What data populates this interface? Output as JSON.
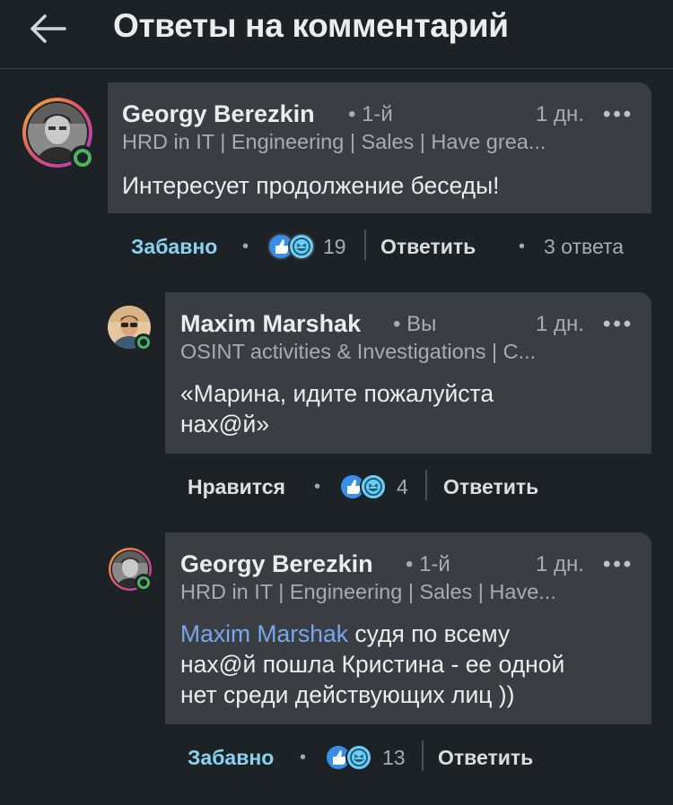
{
  "header": {
    "title": "Ответы на комментарий",
    "back_icon": "back-arrow-icon"
  },
  "colors": {
    "background": "#1d2226",
    "bubble": "#3a3e42",
    "mention": "#77a7ec",
    "funny": "#8ad2ee",
    "online": "#4fb35f"
  },
  "comments": [
    {
      "author": "Georgy Berezkin",
      "degree": "• 1-й",
      "time": "1 дн.",
      "more": "•••",
      "headline": "HRD in IT | Engineering | Sales | Have grea...",
      "text": "Интересует продолжение беседы!",
      "reaction_label": "Забавно",
      "dot": "•",
      "reaction_count": "19",
      "reply_label": "Ответить",
      "replies_dot": "•",
      "replies_count": "3 ответа"
    },
    {
      "author": "Maxim Marshak",
      "degree": "• Вы",
      "time": "1 дн.",
      "more": "•••",
      "headline": "OSINT activities & Investigations | C...",
      "text_line1": "«Марина, идите пожалуйста",
      "text_line2": "нах@й»",
      "reaction_label": "Нравится",
      "dot": "•",
      "reaction_count": "4",
      "reply_label": "Ответить"
    },
    {
      "author": "Georgy Berezkin",
      "degree": "• 1-й",
      "time": "1 дн.",
      "more": "•••",
      "headline": "HRD in IT | Engineering | Sales | Have...",
      "mention": "Maxim Marshak",
      "text_line1": " судя по всему",
      "text_line2": "нах@й пошла Кристина - ее одной",
      "text_line3": "нет среди действующих лиц ))",
      "reaction_label": "Забавно",
      "dot": "•",
      "reaction_count": "13",
      "reply_label": "Ответить"
    }
  ]
}
